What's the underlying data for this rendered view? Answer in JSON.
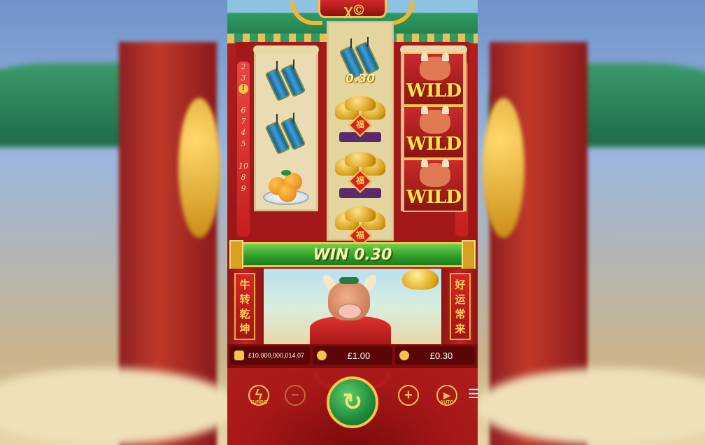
{
  "reels": {
    "left_paylines": [
      "2",
      "3",
      "1",
      "6",
      "7",
      "4",
      "5",
      "10",
      "8",
      "9"
    ],
    "right_paylines": [
      "2",
      "4",
      "1",
      "6",
      "8",
      "3",
      "5",
      "10",
      "7",
      "9"
    ],
    "reel1": [
      "firecracker",
      "firecracker",
      "orange-plate"
    ],
    "reel2": [
      "firecracker",
      "gold-ingot",
      "gold-ingot",
      "gold-ingot"
    ],
    "reel3": [
      "wild",
      "wild",
      "wild"
    ],
    "wild_label": "WILD",
    "ingot_glyph": "福",
    "symbol_win": "0.30"
  },
  "win_banner": {
    "label": "WIN 0.30"
  },
  "scene": {
    "left_couplet": [
      "牛",
      "转",
      "乾",
      "坤"
    ],
    "right_couplet": [
      "好",
      "运",
      "常",
      "来"
    ]
  },
  "balances": {
    "balance": "£10,000,000,014.07",
    "bet": "£1.00",
    "win": "£0.30"
  },
  "controls": {
    "turbo_label": "TURBO",
    "auto_label": "AUTO",
    "minus": "−",
    "plus": "+",
    "spin": "↻",
    "menu": "☰"
  },
  "colors": {
    "frame_red": "#b81e1e",
    "gold": "#f4c54a",
    "win_green": "#2e9b2a"
  }
}
